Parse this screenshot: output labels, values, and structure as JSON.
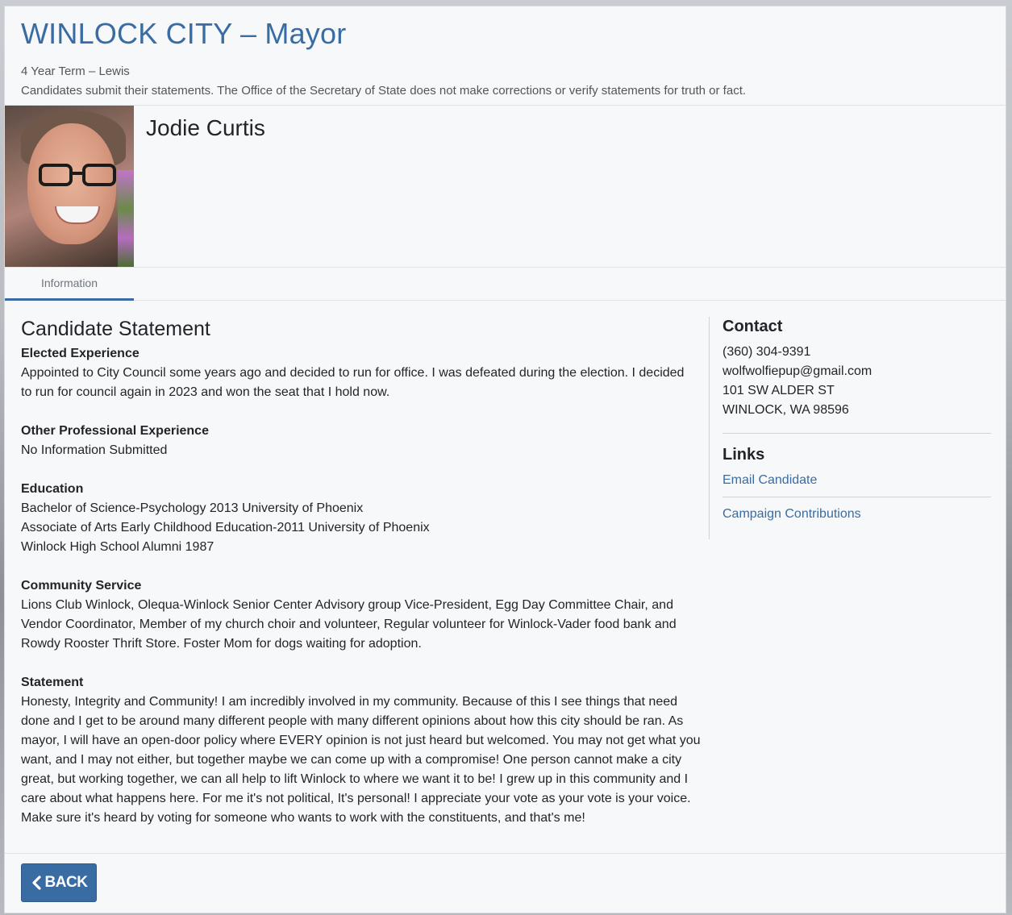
{
  "race": {
    "title": "WINLOCK CITY – Mayor",
    "term": "4 Year Term – Lewis",
    "disclaimer": "Candidates submit their statements. The Office of the Secretary of State does not make corrections or verify statements for truth or fact."
  },
  "candidate": {
    "name": "Jodie Curtis"
  },
  "tabs": [
    {
      "label": "Information",
      "active": true
    }
  ],
  "statement": {
    "heading": "Candidate Statement",
    "sections": [
      {
        "label": "Elected Experience",
        "lines": [
          "Appointed to City Council some years ago and decided to run for office. I was defeated during the election. I decided",
          "to run for council again in 2023 and won the seat that I hold now."
        ]
      },
      {
        "label": "Other Professional Experience",
        "lines": [
          "No Information Submitted"
        ]
      },
      {
        "label": "Education",
        "lines": [
          "Bachelor of Science-Psychology 2013 University of Phoenix",
          "Associate of Arts Early Childhood Education-2011 University of Phoenix",
          "Winlock High School Alumni 1987"
        ]
      },
      {
        "label": "Community Service",
        "lines": [
          "Lions Club Winlock, Olequa-Winlock Senior Center Advisory group Vice-President, Egg Day Committee Chair, and",
          "Vendor Coordinator, Member of my church choir and volunteer, Regular volunteer for Winlock-Vader food bank and",
          "Rowdy Rooster Thrift Store. Foster Mom for dogs waiting for adoption."
        ]
      },
      {
        "label": "Statement",
        "lines": [
          "Honesty, Integrity and Community! I am incredibly involved in my community. Because of this I see things that need",
          "done and I get to be around many different people with many different opinions about how this city should be ran. As",
          "mayor, I will have an open-door policy where EVERY opinion is not just heard but welcomed.  You may not get what you",
          "want, and I may not either, but together maybe we can come up with a compromise! One person cannot make a city",
          "great, but working together, we can all help to lift Winlock to where we want it to be! I grew up in this community and I",
          "care about what happens here. For me it's not political, It's personal! I appreciate your vote as your vote is your voice.",
          "Make sure it's heard by voting for someone who wants to work with the constituents, and that's me!"
        ]
      }
    ]
  },
  "contact": {
    "heading": "Contact",
    "phone": "(360) 304-9391",
    "email": "wolfwolfiepup@gmail.com",
    "address_line1": "101 SW ALDER ST",
    "address_line2": "WINLOCK, WA 98596"
  },
  "links": {
    "heading": "Links",
    "email_candidate": "Email Candidate",
    "campaign_contributions": "Campaign Contributions"
  },
  "footer": {
    "back_label": "BACK"
  },
  "colors": {
    "accent": "#3a6ca4",
    "panel_bg": "#f6f8fa"
  }
}
